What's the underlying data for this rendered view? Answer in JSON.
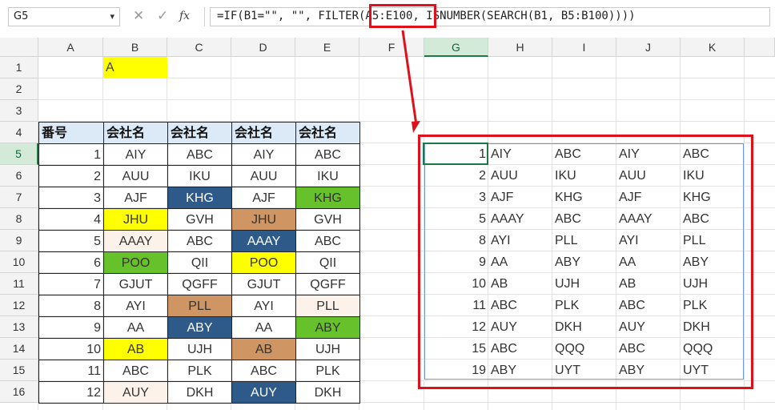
{
  "formula_bar": {
    "name_box": "G5",
    "fx_label": "fx",
    "formula": "=IF(B1=\"\", \"\", FILTER(A5:E100, ISNUMBER(SEARCH(B1, B5:B100))))"
  },
  "columns": [
    "A",
    "B",
    "C",
    "D",
    "E",
    "F",
    "G",
    "H",
    "I",
    "J",
    "K"
  ],
  "rows": [
    "1",
    "2",
    "3",
    "4",
    "5",
    "6",
    "7",
    "8",
    "9",
    "10",
    "11",
    "12",
    "13",
    "14",
    "15",
    "16"
  ],
  "search_value": "A",
  "table": {
    "headers": [
      "番号",
      "会社名",
      "会社名",
      "会社名",
      "会社名"
    ],
    "rows": [
      [
        "1",
        "AIY",
        "ABC",
        "AIY",
        "ABC"
      ],
      [
        "2",
        "AUU",
        "IKU",
        "AUU",
        "IKU"
      ],
      [
        "3",
        "AJF",
        "KHG",
        "AJF",
        "KHG"
      ],
      [
        "4",
        "JHU",
        "GVH",
        "JHU",
        "GVH"
      ],
      [
        "5",
        "AAAY",
        "ABC",
        "AAAY",
        "ABC"
      ],
      [
        "6",
        "POO",
        "QII",
        "POO",
        "QII"
      ],
      [
        "7",
        "GJUT",
        "QGFF",
        "GJUT",
        "QGFF"
      ],
      [
        "8",
        "AYI",
        "PLL",
        "AYI",
        "PLL"
      ],
      [
        "9",
        "AA",
        "ABY",
        "AA",
        "ABY"
      ],
      [
        "10",
        "AB",
        "UJH",
        "AB",
        "UJH"
      ],
      [
        "11",
        "ABC",
        "PLK",
        "ABC",
        "PLK"
      ],
      [
        "12",
        "AUY",
        "DKH",
        "AUY",
        "DKH"
      ]
    ],
    "fills": [
      [
        "",
        "",
        "",
        "",
        ""
      ],
      [
        "",
        "",
        "",
        "",
        ""
      ],
      [
        "",
        "",
        "#2e5a8a",
        "",
        "#66c12a"
      ],
      [
        "",
        "#ffff00",
        "",
        "#cf9563",
        ""
      ],
      [
        "",
        "#fdf2e9",
        "",
        "#2e5a8a",
        ""
      ],
      [
        "",
        "#66c12a",
        "",
        "#ffff00",
        ""
      ],
      [
        "",
        "",
        "",
        "",
        ""
      ],
      [
        "",
        "",
        "#cf9563",
        "",
        "#fdf2e9"
      ],
      [
        "",
        "",
        "#2e5a8a",
        "",
        "#66c12a"
      ],
      [
        "",
        "#ffff00",
        "",
        "#cf9563",
        ""
      ],
      [
        "",
        "",
        "",
        "",
        ""
      ],
      [
        "",
        "#fdf2e9",
        "",
        "#2e5a8a",
        ""
      ]
    ]
  },
  "result": [
    [
      "1",
      "AIY",
      "ABC",
      "AIY",
      "ABC"
    ],
    [
      "2",
      "AUU",
      "IKU",
      "AUU",
      "IKU"
    ],
    [
      "3",
      "AJF",
      "KHG",
      "AJF",
      "KHG"
    ],
    [
      "5",
      "AAAY",
      "ABC",
      "AAAY",
      "ABC"
    ],
    [
      "8",
      "AYI",
      "PLL",
      "AYI",
      "PLL"
    ],
    [
      "9",
      "AA",
      "ABY",
      "AA",
      "ABY"
    ],
    [
      "10",
      "AB",
      "UJH",
      "AB",
      "UJH"
    ],
    [
      "11",
      "ABC",
      "PLK",
      "ABC",
      "PLK"
    ],
    [
      "12",
      "AUY",
      "DKH",
      "AUY",
      "DKH"
    ],
    [
      "15",
      "ABC",
      "QQQ",
      "ABC",
      "QQQ"
    ],
    [
      "19",
      "ABY",
      "UYT",
      "ABY",
      "UYT"
    ]
  ],
  "colors": {
    "highlight": "#e0101a",
    "selection": "#1b7a43",
    "header_fill": "#dce9f6"
  }
}
